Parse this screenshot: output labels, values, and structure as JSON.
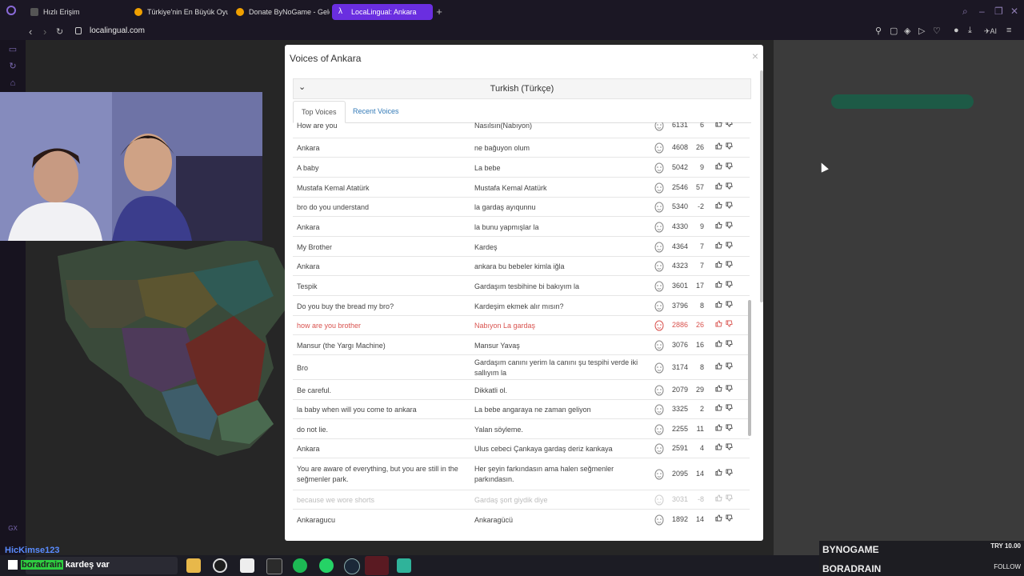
{
  "browser": {
    "tabs": [
      {
        "title": "Hızlı Erişim",
        "active": false
      },
      {
        "title": "Türkiye'nin En Büyük Oyu...",
        "active": false
      },
      {
        "title": "Donate ByNoGame - Gele...",
        "active": false
      },
      {
        "title": "LocaLingual: Ankara",
        "active": true
      }
    ],
    "url": "localingual.com"
  },
  "modal": {
    "title": "Voices of Ankara",
    "language": "Turkish (Türkçe)",
    "tabs": [
      {
        "label": "Top Voices",
        "active": true
      },
      {
        "label": "Recent Voices",
        "active": false
      }
    ],
    "rows": [
      {
        "en": "How are you",
        "tr": "Nasılsın(Nabıyon)",
        "plays": "6131",
        "score": "6",
        "style": "normal"
      },
      {
        "en": "Ankara",
        "tr": "ne bağuyon olum",
        "plays": "4608",
        "score": "26",
        "style": "normal"
      },
      {
        "en": "A baby",
        "tr": "La bebe",
        "plays": "5042",
        "score": "9",
        "style": "normal"
      },
      {
        "en": "Mustafa Kemal Atatürk",
        "tr": "Mustafa Kemal Atatürk",
        "plays": "2546",
        "score": "57",
        "style": "normal"
      },
      {
        "en": "bro do you understand",
        "tr": "la gardaş ayıqunnu",
        "plays": "5340",
        "score": "-2",
        "style": "normal"
      },
      {
        "en": "Ankara",
        "tr": "la bunu yapmışlar la",
        "plays": "4330",
        "score": "9",
        "style": "normal"
      },
      {
        "en": "My Brother",
        "tr": "Kardeş",
        "plays": "4364",
        "score": "7",
        "style": "normal"
      },
      {
        "en": "Ankara",
        "tr": "ankara bu bebeler kimla iğla",
        "plays": "4323",
        "score": "7",
        "style": "normal"
      },
      {
        "en": "Tespik",
        "tr": "Gardaşım tesbihine bi bakıyım la",
        "plays": "3601",
        "score": "17",
        "style": "normal"
      },
      {
        "en": "Do you buy the bread my bro?",
        "tr": "Kardeşim ekmek alır mısın?",
        "plays": "3796",
        "score": "8",
        "style": "normal"
      },
      {
        "en": "how are you brother",
        "tr": "Nabıyon La gardaş",
        "plays": "2886",
        "score": "26",
        "style": "red"
      },
      {
        "en": "Mansur (the Yargı Machine)",
        "tr": "Mansur Yavaş",
        "plays": "3076",
        "score": "16",
        "style": "normal"
      },
      {
        "en": "Bro",
        "tr": "Gardaşım canını yerim la canını şu tespihi verde iki sallıyım la",
        "plays": "3174",
        "score": "8",
        "style": "normal"
      },
      {
        "en": "Be careful.",
        "tr": "Dikkatli ol.",
        "plays": "2079",
        "score": "29",
        "style": "normal"
      },
      {
        "en": "la baby when will you come to ankara",
        "tr": "La bebe angaraya ne zaman geliyon",
        "plays": "3325",
        "score": "2",
        "style": "normal"
      },
      {
        "en": "do not lie.",
        "tr": "Yalan söyleme.",
        "plays": "2255",
        "score": "11",
        "style": "normal"
      },
      {
        "en": "Ankara",
        "tr": "Ulus cebeci Çankaya gardaş deriz kankaya",
        "plays": "2591",
        "score": "4",
        "style": "normal"
      },
      {
        "en": "You are aware of everything, but you are still in the seğmenler park.",
        "tr": "Her şeyin farkındasın ama halen seğmenler parkındasın.",
        "plays": "2095",
        "score": "14",
        "style": "normal"
      },
      {
        "en": "because we wore shorts",
        "tr": "Gardaş şort giydik diye",
        "plays": "3031",
        "score": "-8",
        "style": "faded"
      },
      {
        "en": "Ankaragucu",
        "tr": "Ankaragücü",
        "plays": "1892",
        "score": "14",
        "style": "normal"
      }
    ]
  },
  "overlay": {
    "chat_user": "HicKimse123",
    "chat_prefix": "boradrain",
    "chat_msg": "kardeş var",
    "sponsor_top": "BYNOGAME",
    "sponsor_bottom": "BORADRAIN",
    "sponsor_amount": "TRY 10.00",
    "follow": "FOLLOW"
  },
  "colors": {
    "accent": "#6a2ee0",
    "link": "#337ab7",
    "highlight": "#d9534f"
  }
}
